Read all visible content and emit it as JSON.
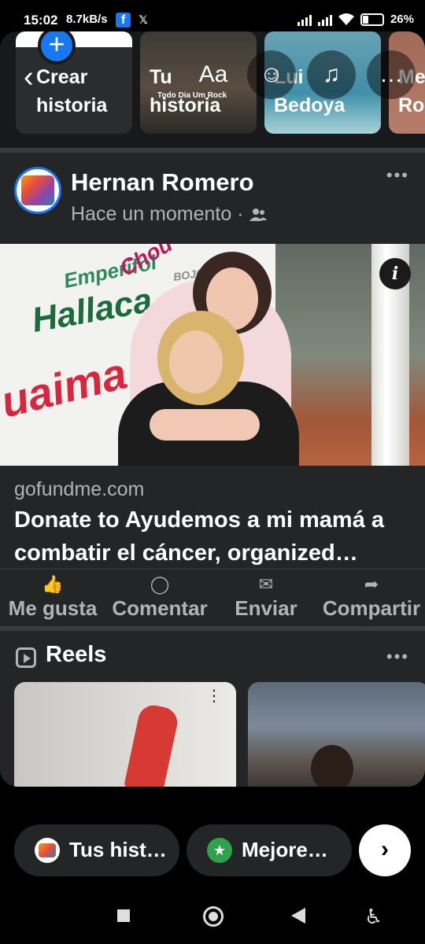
{
  "status_bar": {
    "time": "15:02",
    "speed": "8.7kB/s",
    "battery": "26%",
    "fb_letter": "f",
    "x_letter": "𝕏"
  },
  "stories": {
    "create_line1": "Crear",
    "create_line2": "historia",
    "story2_line1": "Tu",
    "story2_line2": "historia",
    "story2_watermark": "Todo Dia Um Rock",
    "story3_line1": "Lui",
    "story3_line2": "Bedoya",
    "story4_line1": "Me",
    "story4_line2": "Ro",
    "controls": {
      "back": "‹",
      "text": "Aa",
      "sticker": "☺",
      "music": "♫",
      "more": "…"
    }
  },
  "post": {
    "author": "Hernan Romero",
    "time": "Hace un momento · ",
    "audience_icon": "friends-icon",
    "more": "•••",
    "image_text": {
      "word1": "Hallaca",
      "word2": "Emperifol",
      "word3": "uaima",
      "word4": "Chou",
      "word5": "BOJOTE"
    },
    "info": "i",
    "link_domain": "gofundme.com",
    "link_title": "Donate to Ayudemos a mi mamá a combatir el cáncer, organized…"
  },
  "actions": {
    "like": "Me gusta",
    "comment": "Comentar",
    "send": "Enviar",
    "share": "Compartir",
    "like_icon": "👍",
    "comment_icon": "◯",
    "send_icon": "✉",
    "share_icon": "➦"
  },
  "reels": {
    "title": "Reels",
    "more": "•••",
    "dots": "⋮"
  },
  "bottom": {
    "pill1": "Tus hist…",
    "pill2": "Mejore…",
    "star": "★",
    "next": "›"
  },
  "nav": {
    "accessibility": "♿"
  },
  "colors": {
    "accent": "#1877f2",
    "surface": "#242526",
    "text_secondary": "#b0b3b8"
  }
}
